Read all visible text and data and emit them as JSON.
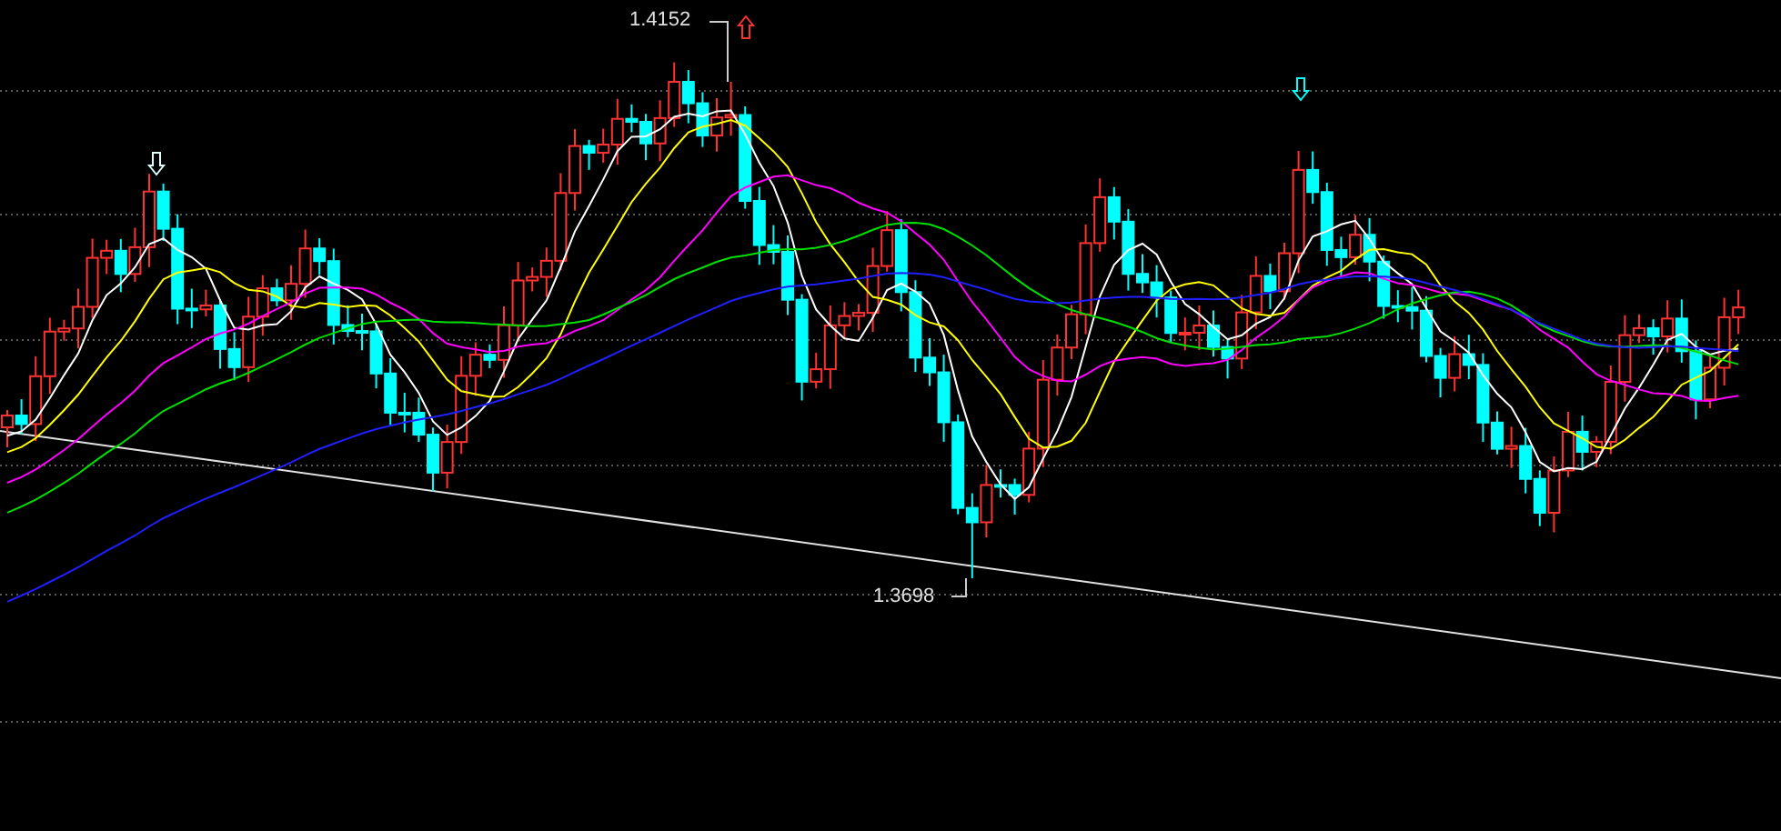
{
  "chart": {
    "high_label": "1.4152",
    "low_label": "1.3698"
  }
}
